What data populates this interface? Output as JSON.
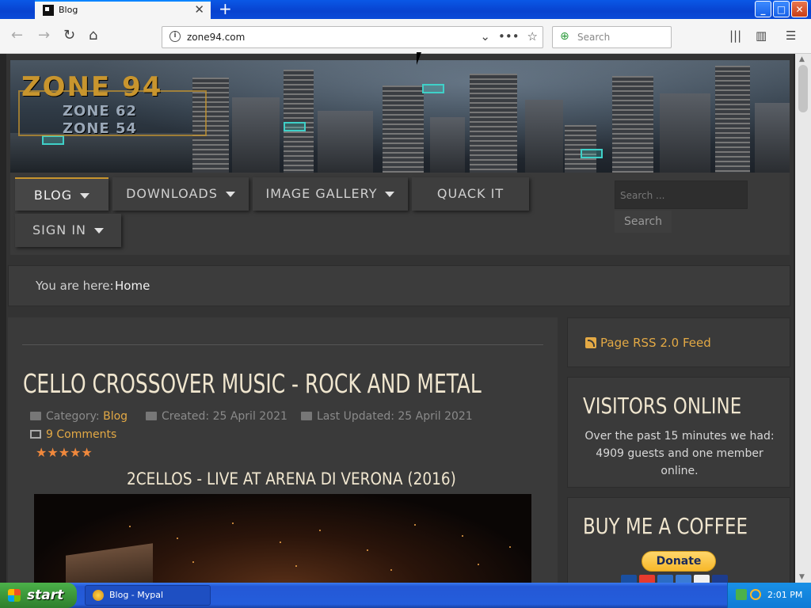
{
  "browser": {
    "tab_title": "Blog",
    "url": "zone94.com",
    "search_placeholder": "Search",
    "new_tab": "+",
    "tab_close": "✕"
  },
  "site": {
    "logo_main": "ZONE 94",
    "logo_sub1": "ZONE 62",
    "logo_sub2": "ZONE 54",
    "nav": [
      {
        "label": "BLOG",
        "caret": true
      },
      {
        "label": "DOWNLOADS",
        "caret": true
      },
      {
        "label": "IMAGE GALLERY",
        "caret": true
      },
      {
        "label": "QUACK IT",
        "caret": false
      },
      {
        "label": "SIGN IN",
        "caret": true
      }
    ],
    "search_placeholder": "Search ...",
    "search_button": "Search",
    "breadcrumb_label": "You are here:",
    "breadcrumb_home": "Home"
  },
  "article": {
    "title": "CELLO CROSSOVER MUSIC - ROCK AND METAL",
    "category_label": "Category:",
    "category": "Blog",
    "created": "Created: 25 April 2021",
    "updated": "Last Updated: 25 April 2021",
    "comments": "9 Comments",
    "rating_stars": 5,
    "stars_text": "★★★★★",
    "subtitle": "2CELLOS - LIVE AT ARENA DI VERONA (2016)"
  },
  "sidebar": {
    "rss": "Page RSS 2.0 Feed",
    "visitors_title": "VISITORS ONLINE",
    "visitors_body": "Over the past 15 minutes we had: 4909 guests and one member online.",
    "coffee_title": "BUY ME A COFFEE",
    "donate": "Donate"
  },
  "taskbar": {
    "start": "start",
    "task": "Blog - Mypal",
    "clock": "2:01 PM"
  },
  "colors": {
    "accent": "#e3a945",
    "heading": "#f0e6cf",
    "panel": "#3a3a3a",
    "xp_blue": "#245ddb"
  }
}
